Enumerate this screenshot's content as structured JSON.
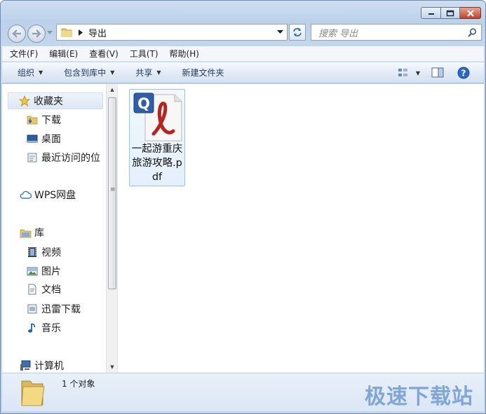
{
  "address": {
    "crumb": "导出"
  },
  "search": {
    "placeholder": "搜索 导出"
  },
  "menubar": [
    "文件(F)",
    "编辑(E)",
    "查看(V)",
    "工具(T)",
    "帮助(H)"
  ],
  "commandbar": {
    "organize": "组织",
    "include_library": "包含到库中",
    "share": "共享",
    "new_folder": "新建文件夹"
  },
  "navigation": {
    "favorites": {
      "label": "收藏夹",
      "items": [
        "下载",
        "桌面",
        "最近访问的位"
      ]
    },
    "wps": "WPS网盘",
    "libraries": {
      "label": "库",
      "items": [
        "视频",
        "图片",
        "文档",
        "迅雷下载",
        "音乐"
      ]
    },
    "computer": "计算机"
  },
  "files": [
    {
      "name": "一起游重庆旅游攻略.pdf",
      "icon": "pdf-reader-icon"
    }
  ],
  "status": {
    "count_text": "1 个对象"
  },
  "watermark": "极速下载站"
}
